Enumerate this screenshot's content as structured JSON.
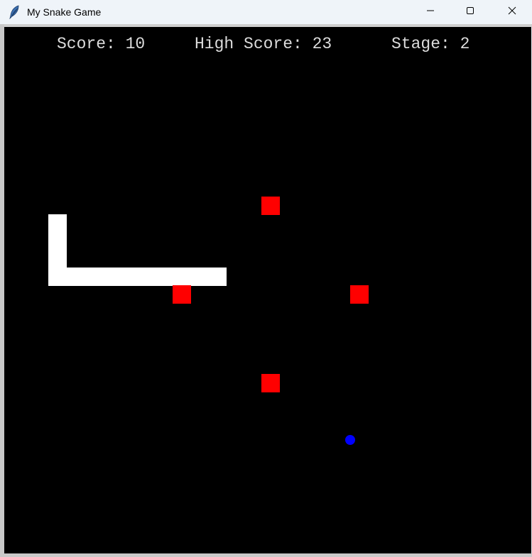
{
  "window": {
    "title": "My Snake Game",
    "app_icon": "feather-icon",
    "controls": [
      "minimize-icon",
      "maximize-icon",
      "close-icon"
    ]
  },
  "hud": {
    "score_text": "Score: 10",
    "high_score_text": "High Score: 23",
    "stage_text": "Stage: 2"
  },
  "game": {
    "score": 10,
    "high_score": 23,
    "stage": 2,
    "colors": {
      "background": "#000000",
      "snake": "#ffffff",
      "obstacle": "#ff0000",
      "food": "#0000ff",
      "hud_text": "#dcdcdc"
    }
  }
}
